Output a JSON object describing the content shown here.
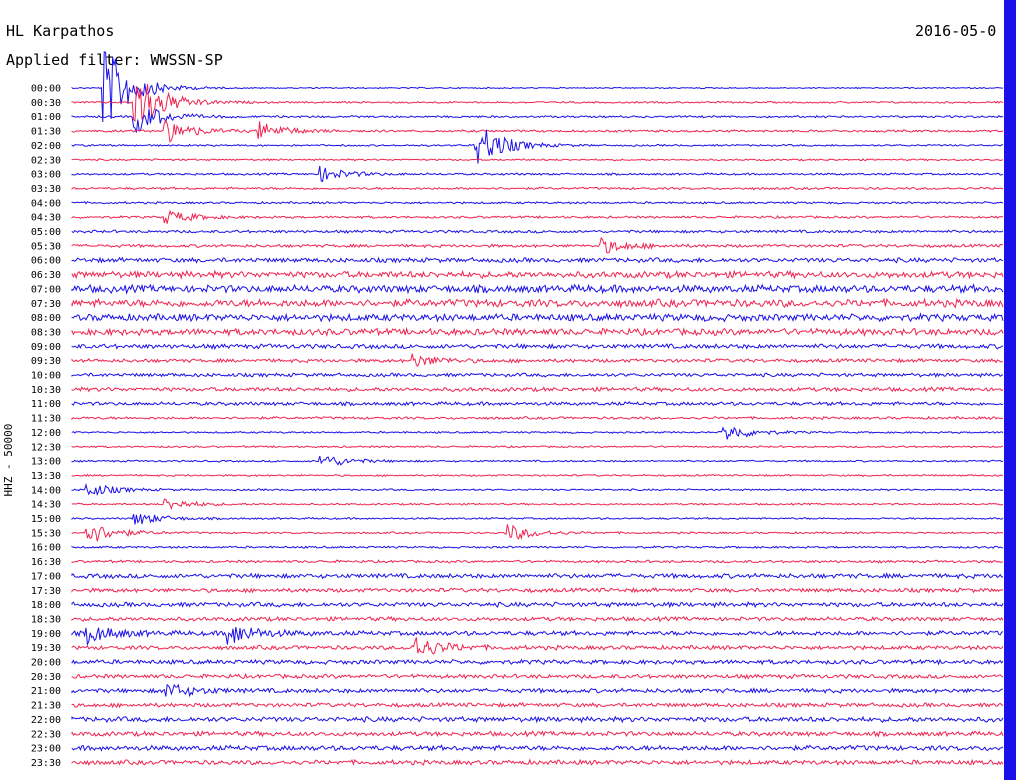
{
  "header": {
    "station": "HL Karpathos",
    "filter": "Applied filter: WWSSN-SP",
    "date": "2016-05-0"
  },
  "chart_data": {
    "type": "line",
    "title": "HL Karpathos",
    "subtitle": "Applied filter: WWSSN-SP",
    "ylabel": "HHZ - 50000",
    "row_labels": [
      "00:00",
      "00:30",
      "01:00",
      "01:30",
      "02:00",
      "02:30",
      "03:00",
      "03:30",
      "04:00",
      "04:30",
      "05:00",
      "05:30",
      "06:00",
      "06:30",
      "07:00",
      "07:30",
      "08:00",
      "08:30",
      "09:00",
      "09:30",
      "10:00",
      "10:30",
      "11:00",
      "11:30",
      "12:00",
      "12:30",
      "13:00",
      "13:30",
      "14:00",
      "14:30",
      "15:00",
      "15:30",
      "16:00",
      "16:30",
      "17:00",
      "17:30",
      "18:00",
      "18:30",
      "19:00",
      "19:30",
      "20:00",
      "20:30",
      "21:00",
      "21:30",
      "22:00",
      "22:30",
      "23:00",
      "23:30"
    ],
    "colors": {
      "even": "#1a10e8",
      "odd": "#f0234f"
    },
    "relative_noise": [
      0.25,
      0.35,
      0.4,
      0.45,
      0.35,
      0.35,
      0.4,
      0.45,
      0.4,
      0.45,
      0.55,
      0.6,
      0.9,
      1.3,
      1.5,
      1.5,
      1.4,
      1.3,
      0.9,
      0.7,
      0.7,
      0.8,
      0.7,
      0.5,
      0.35,
      0.35,
      0.35,
      0.35,
      0.35,
      0.35,
      0.35,
      0.35,
      0.4,
      0.5,
      0.9,
      0.8,
      0.9,
      0.8,
      0.9,
      0.8,
      0.85,
      0.8,
      0.85,
      0.8,
      1.0,
      0.9,
      1.0,
      0.9
    ],
    "events": [
      {
        "row": 0,
        "minute": 1,
        "amplitude": 8
      },
      {
        "row": 1,
        "minute": 2,
        "amplitude": 6
      },
      {
        "row": 2,
        "minute": 2,
        "amplitude": 3
      },
      {
        "row": 3,
        "minute": 3,
        "amplitude": 2
      },
      {
        "row": 3,
        "minute": 6,
        "amplitude": 1.5
      },
      {
        "row": 4,
        "minute": 13,
        "amplitude": 4
      },
      {
        "row": 6,
        "minute": 8,
        "amplitude": 1.2
      },
      {
        "row": 9,
        "minute": 3,
        "amplitude": 1.2
      },
      {
        "row": 11,
        "minute": 17,
        "amplitude": 1.3
      },
      {
        "row": 19,
        "minute": 11,
        "amplitude": 1
      },
      {
        "row": 24,
        "minute": 21,
        "amplitude": 1.5
      },
      {
        "row": 26,
        "minute": 8,
        "amplitude": 1.2
      },
      {
        "row": 28,
        "minute": 0.5,
        "amplitude": 1.2
      },
      {
        "row": 29,
        "minute": 3,
        "amplitude": 1
      },
      {
        "row": 30,
        "minute": 2,
        "amplitude": 1.2
      },
      {
        "row": 31,
        "minute": 0.5,
        "amplitude": 2
      },
      {
        "row": 31,
        "minute": 14,
        "amplitude": 1.5
      },
      {
        "row": 38,
        "minute": 0.5,
        "amplitude": 1.5
      },
      {
        "row": 38,
        "minute": 5,
        "amplitude": 2
      },
      {
        "row": 39,
        "minute": 11,
        "amplitude": 2
      },
      {
        "row": 42,
        "minute": 3,
        "amplitude": 1.3
      }
    ]
  }
}
